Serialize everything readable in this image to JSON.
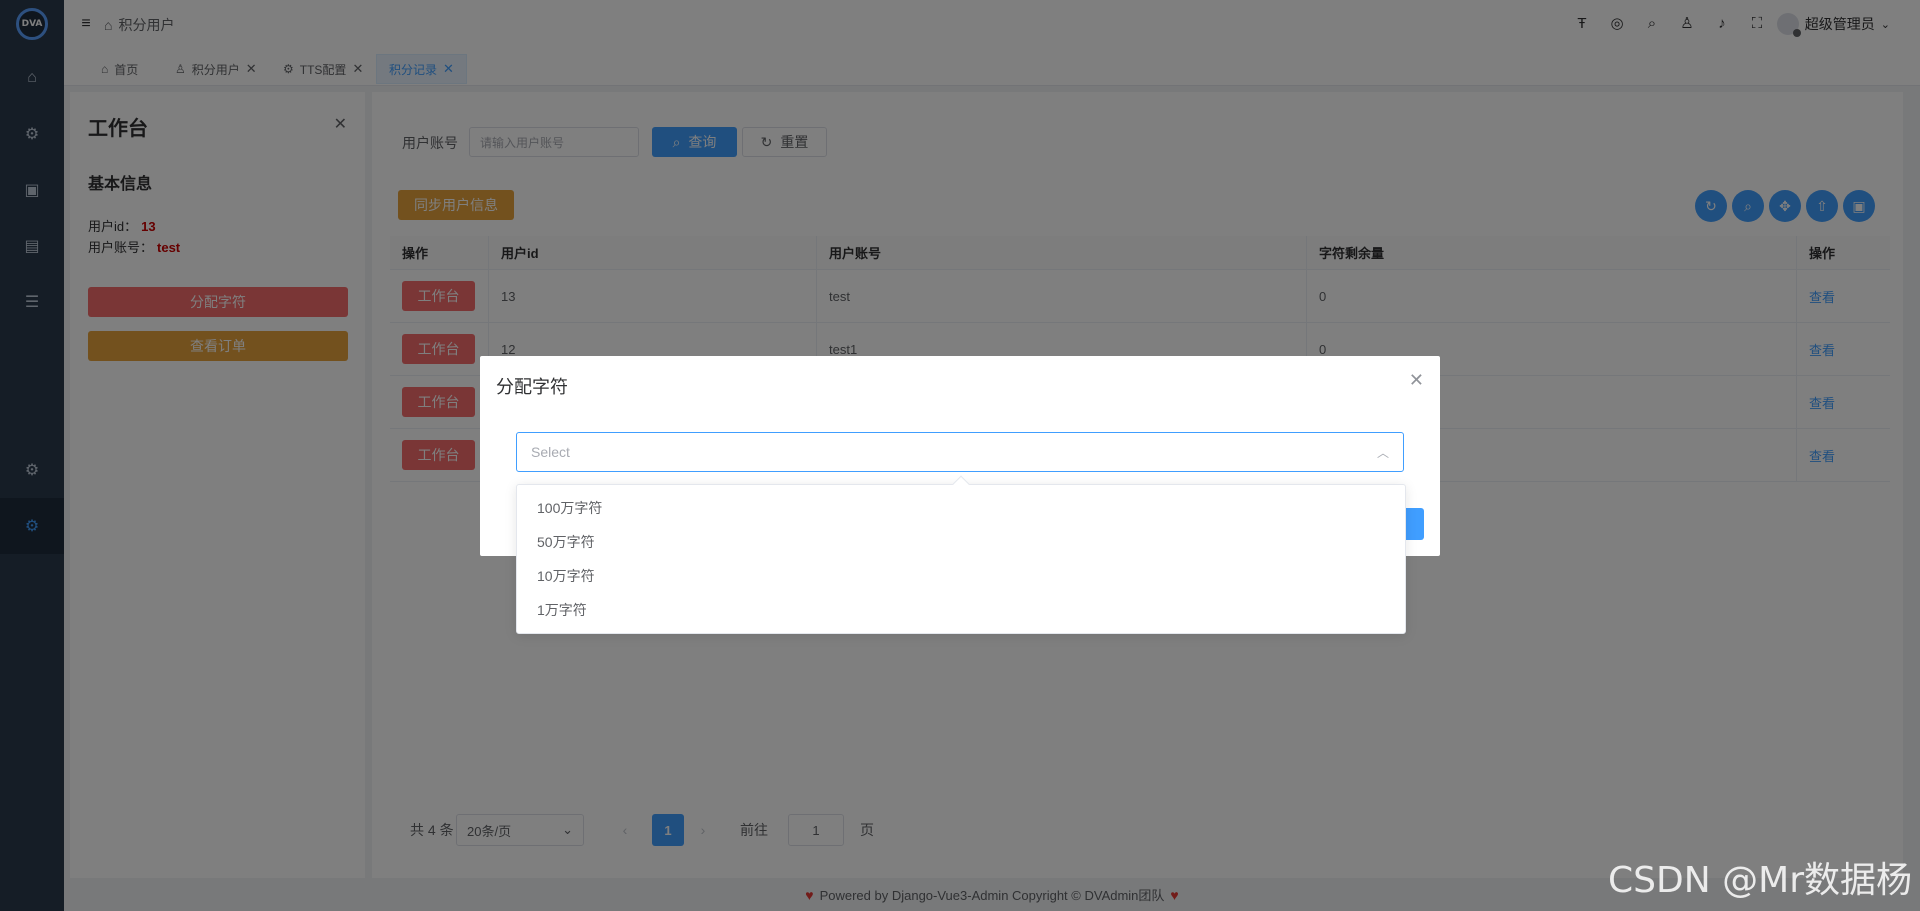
{
  "logo": {
    "text": "DVA"
  },
  "sidebar": {
    "icons": [
      "home-icon",
      "gear-icon",
      "document-icon",
      "form-icon",
      "list-icon",
      "settings-icon",
      "active-settings-icon"
    ]
  },
  "header": {
    "breadcrumb": "积分用户",
    "user_name": "超级管理员"
  },
  "tabs": [
    {
      "label": "首页"
    },
    {
      "label": "积分用户"
    },
    {
      "label": "TTS配置"
    },
    {
      "label": "积分记录"
    }
  ],
  "panel": {
    "title": "工作台",
    "section_title": "基本信息",
    "user_id_label": "用户id：",
    "user_id_value": "13",
    "user_account_label": "用户账号：",
    "user_account_value": "test",
    "assign_button": "分配字符",
    "orders_button": "查看订单"
  },
  "search": {
    "label": "用户账号",
    "placeholder": "请输入用户账号",
    "query_button": "查询",
    "reset_button": "重置"
  },
  "toolbar": {
    "sync_button": "同步用户信息"
  },
  "table": {
    "headers": [
      "操作",
      "用户id",
      "用户账号",
      "字符剩余量",
      "操作"
    ],
    "rows": [
      {
        "action": "工作台",
        "id": "13",
        "account": "test",
        "remaining": "0",
        "link": "查看"
      },
      {
        "action": "工作台",
        "id": "12",
        "account": "test1",
        "remaining": "0",
        "link": "查看"
      },
      {
        "action": "工作台",
        "id": "",
        "account": "",
        "remaining": "",
        "link": "查看"
      },
      {
        "action": "工作台",
        "id": "",
        "account": "",
        "remaining": "",
        "link": "查看"
      }
    ]
  },
  "pagination": {
    "total": "共 4 条",
    "page_size": "20条/页",
    "current": "1",
    "goto_label": "前往",
    "goto_value": "1",
    "page_suffix": "页"
  },
  "footer": {
    "text": "Powered by Django-Vue3-Admin Copyright © DVAdmin团队"
  },
  "dialog": {
    "title": "分配字符",
    "select_placeholder": "Select",
    "options": [
      "100万字符",
      "50万字符",
      "10万字符",
      "1万字符"
    ]
  },
  "watermark": "CSDN @Mr数据杨",
  "colors": {
    "primary": "#409eff",
    "danger": "#f56c6c",
    "warning": "#e6a23c",
    "sidebar": "#2b3a4d"
  }
}
